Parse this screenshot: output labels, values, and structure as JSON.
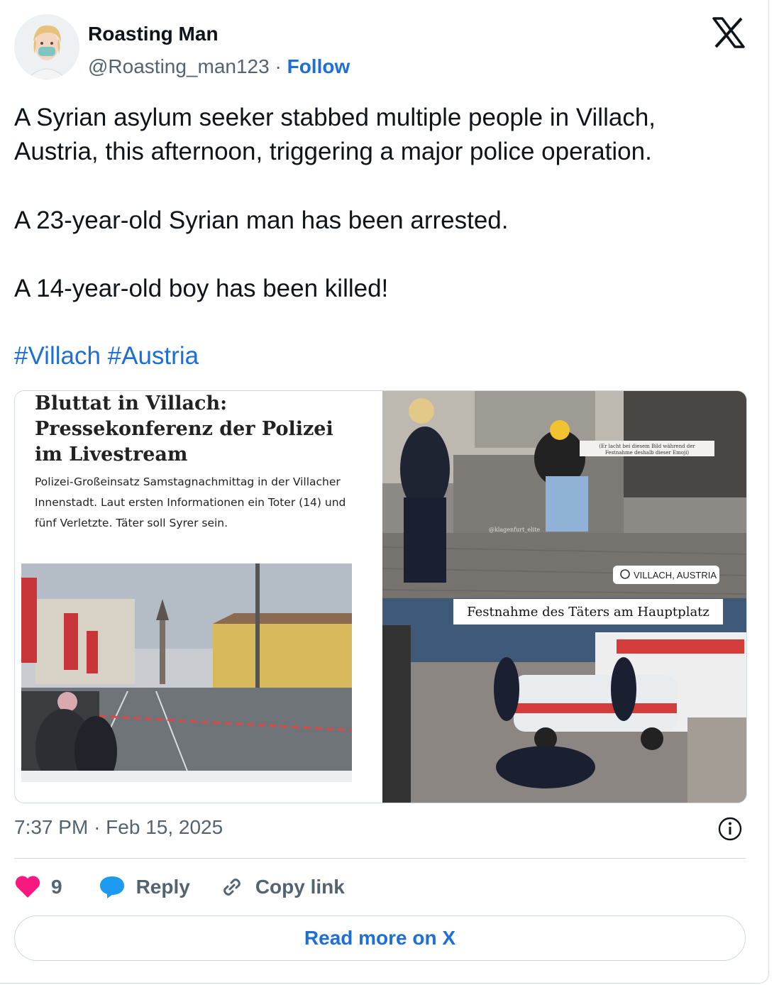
{
  "author": {
    "name": "Roasting Man",
    "handle": "@Roasting_man123",
    "separator": "·",
    "follow_label": "Follow"
  },
  "tweet": {
    "paragraph1_line1": "A Syrian asylum seeker stabbed multiple people in Villach,",
    "paragraph1_line2": "Austria, this afternoon, triggering a major police operation.",
    "paragraph2": "A 23-year-old Syrian man has been arrested.",
    "paragraph3": "A 14-year-old boy has been killed!",
    "hashtags": "#Villach #Austria"
  },
  "media": {
    "article_title_line1": "Bluttat in Villach:",
    "article_title_line2": "Pressekonferenz der Polizei",
    "article_title_line3": "im Livestream",
    "article_desc": "Polizei-Großeinsatz Samstagnachmittag in der Villacher Innenstadt. Laut ersten Informationen ein Toter (14) und fünf Verletzte. Täter soll Syrer sein.",
    "photo_caption_small": "(Er lacht bei diesem Bild während der Festnahme deshalb dieser Emoji)",
    "photo_watermark": "@klagenfurt_elite",
    "photo_location": "VILLACH, AUSTRIA",
    "photo_headline": "Festnahme des Täters am Hauptplatz"
  },
  "meta": {
    "time": "7:37 PM",
    "separator": "·",
    "date": "Feb 15, 2025"
  },
  "actions": {
    "like_count": "9",
    "reply_label": "Reply",
    "copy_label": "Copy link"
  },
  "read_more_label": "Read more on X",
  "colors": {
    "accent": "#1d6fd6",
    "like": "#f91880",
    "reply_icon": "#1d9bf0",
    "text": "#0f1419",
    "muted": "#536471",
    "border": "#cfd9de"
  }
}
